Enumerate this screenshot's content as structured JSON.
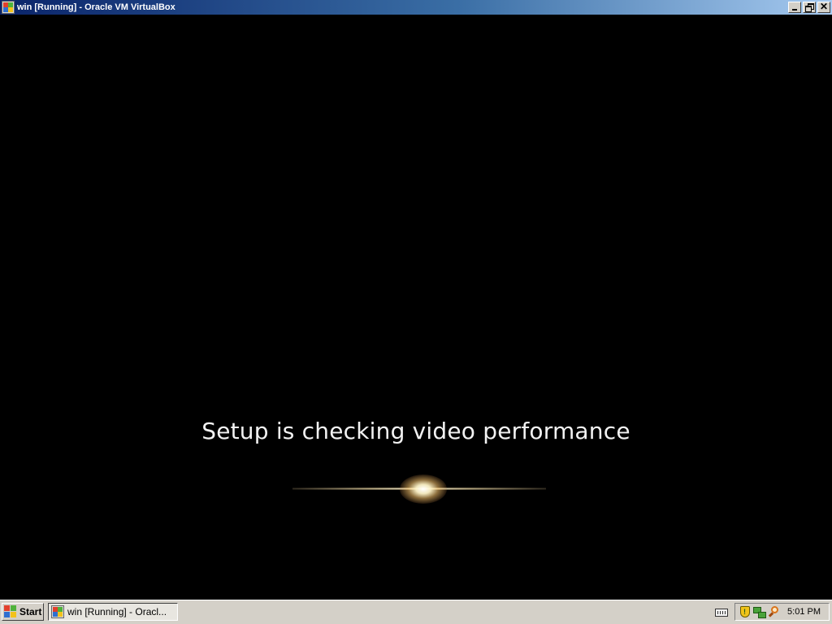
{
  "window": {
    "title": "win [Running] - Oracle VM VirtualBox",
    "icon": "virtualbox-vm-icon",
    "buttons": {
      "minimize": "minimize-icon",
      "restore": "restore-icon",
      "close": "close-icon"
    }
  },
  "vm": {
    "message": "Setup is checking video performance",
    "animation": "glowing-light-streak"
  },
  "taskbar": {
    "start_label": "Start",
    "task_button_label": "win [Running] - Oracl...",
    "tray": {
      "icons": [
        "keyboard-icon",
        "shield-icon",
        "network-icon",
        "magnifier-icon"
      ],
      "clock": "5:01 PM"
    }
  },
  "colors": {
    "title_bar_start": "#0a246a",
    "title_bar_end": "#a6caf0",
    "taskbar": "#d4d0c8",
    "vm_background": "#000000",
    "message_text": "#f2f2f2"
  }
}
